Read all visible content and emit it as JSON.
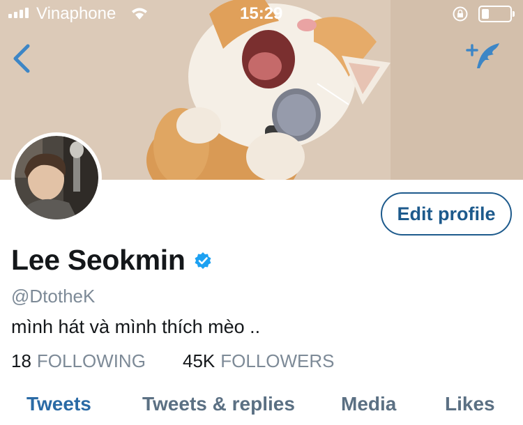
{
  "status_bar": {
    "carrier": "Vinaphone",
    "time": "15:29",
    "battery_level": 0.25
  },
  "nav": {
    "back_icon": "chevron-left-icon",
    "compose_icon": "compose-tweet-icon",
    "accent_color": "#3d86c6"
  },
  "profile": {
    "display_name": "Lee Seokmin",
    "verified": true,
    "verified_color": "#1da1f2",
    "handle": "@DtotheK",
    "bio": "mình hát và mình thích mèo ..",
    "edit_button_label": "Edit profile",
    "following_count": "18",
    "following_label": "FOLLOWING",
    "followers_count": "45K",
    "followers_label": "FOLLOWERS"
  },
  "tabs": [
    {
      "label": "Tweets",
      "active": true
    },
    {
      "label": "Tweets & replies",
      "active": false
    },
    {
      "label": "Media",
      "active": false
    },
    {
      "label": "Likes",
      "active": false
    }
  ]
}
